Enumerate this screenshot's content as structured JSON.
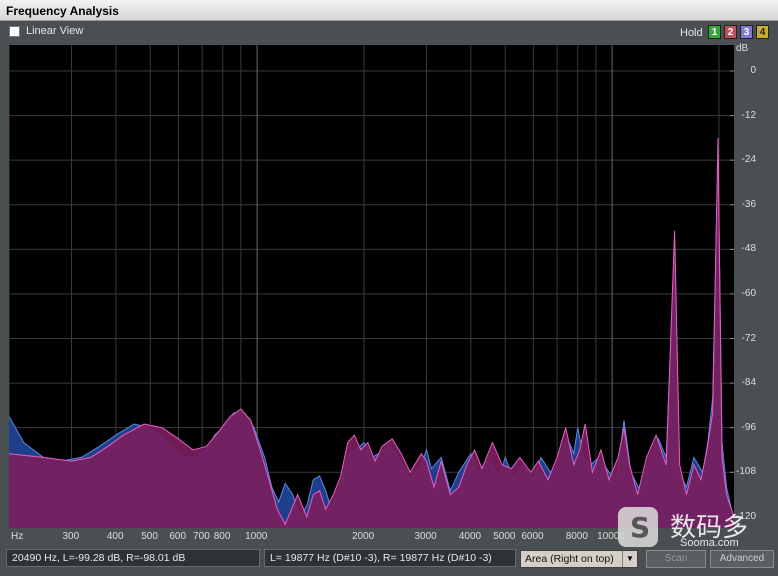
{
  "window": {
    "title": "Frequency Analysis"
  },
  "toolbar": {
    "linear_view_label": "Linear View",
    "linear_view_checked": false,
    "hold_label": "Hold",
    "hold_buttons": [
      "1",
      "2",
      "3",
      "4"
    ]
  },
  "colors": {
    "plot_background": "#000000",
    "grid": "#3a3a3a",
    "left_channel_fill": "#1d3f8c",
    "right_channel_fill": "#7a1e5e",
    "right_channel_line": "#e85fc4",
    "left_channel_line": "#5a8ae0"
  },
  "chart_data": {
    "type": "area",
    "xscale": "log",
    "xlabel": "Hz",
    "ylabel": "dB",
    "xlim": [
      200,
      22050
    ],
    "ylim": [
      -123,
      7
    ],
    "yticks": [
      0,
      -12,
      -24,
      -36,
      -48,
      -60,
      -72,
      -84,
      -96,
      -108,
      -120
    ],
    "xticks": [
      {
        "value": 300,
        "label": "300"
      },
      {
        "value": 400,
        "label": "400"
      },
      {
        "value": 500,
        "label": "500"
      },
      {
        "value": 600,
        "label": "600"
      },
      {
        "value": 700,
        "label": "700"
      },
      {
        "value": 800,
        "label": "800"
      },
      {
        "value": 1000,
        "label": "1000"
      },
      {
        "value": 2000,
        "label": "2000"
      },
      {
        "value": 3000,
        "label": "3000"
      },
      {
        "value": 4000,
        "label": "4000"
      },
      {
        "value": 5000,
        "label": "5000"
      },
      {
        "value": 6000,
        "label": "6000"
      },
      {
        "value": 8000,
        "label": "8000"
      },
      {
        "value": 10000,
        "label": "10000"
      }
    ],
    "series": [
      {
        "values_db": [
          [
            200,
            -93
          ],
          [
            220,
            -100
          ],
          [
            250,
            -104
          ],
          [
            280,
            -105
          ],
          [
            320,
            -104
          ],
          [
            360,
            -101
          ],
          [
            400,
            -98
          ],
          [
            450,
            -95
          ],
          [
            500,
            -96
          ],
          [
            560,
            -100
          ],
          [
            620,
            -104
          ],
          [
            680,
            -104
          ],
          [
            720,
            -102
          ],
          [
            760,
            -98
          ],
          [
            800,
            -96
          ],
          [
            860,
            -92
          ],
          [
            920,
            -92
          ],
          [
            980,
            -96
          ],
          [
            1050,
            -104
          ],
          [
            1100,
            -112
          ],
          [
            1150,
            -116
          ],
          [
            1200,
            -111
          ],
          [
            1260,
            -114
          ],
          [
            1320,
            -120
          ],
          [
            1380,
            -117
          ],
          [
            1440,
            -110
          ],
          [
            1500,
            -109
          ],
          [
            1560,
            -113
          ],
          [
            1620,
            -118
          ],
          [
            1700,
            -113
          ],
          [
            1800,
            -104
          ],
          [
            1900,
            -102
          ],
          [
            2000,
            -100
          ],
          [
            2100,
            -104
          ],
          [
            2200,
            -103
          ],
          [
            2350,
            -101
          ],
          [
            2500,
            -104
          ],
          [
            2700,
            -110
          ],
          [
            2900,
            -106
          ],
          [
            3000,
            -102
          ],
          [
            3100,
            -107
          ],
          [
            3300,
            -104
          ],
          [
            3500,
            -113
          ],
          [
            3700,
            -108
          ],
          [
            4000,
            -103
          ],
          [
            4200,
            -108
          ],
          [
            4500,
            -104
          ],
          [
            4800,
            -110
          ],
          [
            5000,
            -104
          ],
          [
            5300,
            -110
          ],
          [
            5600,
            -106
          ],
          [
            6000,
            -110
          ],
          [
            6300,
            -104
          ],
          [
            6700,
            -108
          ],
          [
            7000,
            -106
          ],
          [
            7500,
            -99
          ],
          [
            7800,
            -103
          ],
          [
            8000,
            -96
          ],
          [
            8300,
            -104
          ],
          [
            8700,
            -106
          ],
          [
            9200,
            -104
          ],
          [
            9800,
            -108
          ],
          [
            10300,
            -110
          ],
          [
            10800,
            -94
          ],
          [
            11300,
            -108
          ],
          [
            12000,
            -113
          ],
          [
            12800,
            -104
          ],
          [
            13500,
            -99
          ],
          [
            14200,
            -104
          ],
          [
            15000,
            -47
          ],
          [
            15400,
            -108
          ],
          [
            16200,
            -112
          ],
          [
            17000,
            -104
          ],
          [
            18000,
            -108
          ],
          [
            18600,
            -100
          ],
          [
            19200,
            -88
          ],
          [
            19877,
            -23
          ],
          [
            20400,
            -100
          ],
          [
            21000,
            -112
          ],
          [
            22050,
            -121
          ]
        ]
      },
      {
        "values_db": [
          [
            200,
            -103
          ],
          [
            250,
            -104
          ],
          [
            300,
            -105
          ],
          [
            340,
            -104
          ],
          [
            380,
            -101
          ],
          [
            420,
            -98
          ],
          [
            480,
            -95
          ],
          [
            540,
            -96
          ],
          [
            600,
            -99
          ],
          [
            660,
            -102
          ],
          [
            720,
            -101
          ],
          [
            780,
            -97
          ],
          [
            840,
            -93
          ],
          [
            900,
            -91
          ],
          [
            960,
            -94
          ],
          [
            1020,
            -102
          ],
          [
            1080,
            -110
          ],
          [
            1140,
            -118
          ],
          [
            1200,
            -122
          ],
          [
            1250,
            -118
          ],
          [
            1300,
            -114
          ],
          [
            1380,
            -120
          ],
          [
            1440,
            -114
          ],
          [
            1500,
            -113
          ],
          [
            1560,
            -118
          ],
          [
            1640,
            -114
          ],
          [
            1720,
            -109
          ],
          [
            1800,
            -100
          ],
          [
            1880,
            -98
          ],
          [
            1960,
            -102
          ],
          [
            2050,
            -100
          ],
          [
            2150,
            -105
          ],
          [
            2250,
            -101
          ],
          [
            2400,
            -99
          ],
          [
            2550,
            -103
          ],
          [
            2700,
            -108
          ],
          [
            2900,
            -103
          ],
          [
            3000,
            -105
          ],
          [
            3150,
            -112
          ],
          [
            3300,
            -105
          ],
          [
            3500,
            -114
          ],
          [
            3700,
            -112
          ],
          [
            3900,
            -106
          ],
          [
            4100,
            -102
          ],
          [
            4300,
            -107
          ],
          [
            4600,
            -100
          ],
          [
            4900,
            -106
          ],
          [
            5200,
            -107
          ],
          [
            5500,
            -104
          ],
          [
            5900,
            -108
          ],
          [
            6200,
            -105
          ],
          [
            6600,
            -110
          ],
          [
            7000,
            -104
          ],
          [
            7400,
            -96
          ],
          [
            7800,
            -106
          ],
          [
            8100,
            -102
          ],
          [
            8400,
            -95
          ],
          [
            8800,
            -108
          ],
          [
            9300,
            -102
          ],
          [
            9800,
            -110
          ],
          [
            10400,
            -104
          ],
          [
            10800,
            -96
          ],
          [
            11200,
            -106
          ],
          [
            11800,
            -114
          ],
          [
            12500,
            -104
          ],
          [
            13300,
            -98
          ],
          [
            14200,
            -106
          ],
          [
            15000,
            -43
          ],
          [
            15500,
            -106
          ],
          [
            16200,
            -114
          ],
          [
            17000,
            -106
          ],
          [
            17800,
            -110
          ],
          [
            18500,
            -102
          ],
          [
            19200,
            -92
          ],
          [
            19877,
            -18
          ],
          [
            20400,
            -104
          ],
          [
            21000,
            -114
          ],
          [
            22050,
            -120
          ]
        ]
      }
    ]
  },
  "status": {
    "cursor_readout": "20490 Hz, L=-99.28 dB, R=-98.01 dB",
    "peak_readout": "L=  19877 Hz (D#10 -3), R=  19877 Hz (D#10 -3)",
    "view_mode": "Area (Right on top)",
    "scan_label": "Scan",
    "advanced_label": "Advanced"
  },
  "watermark": {
    "chinese": "数码多",
    "site": "Sooma.com"
  }
}
